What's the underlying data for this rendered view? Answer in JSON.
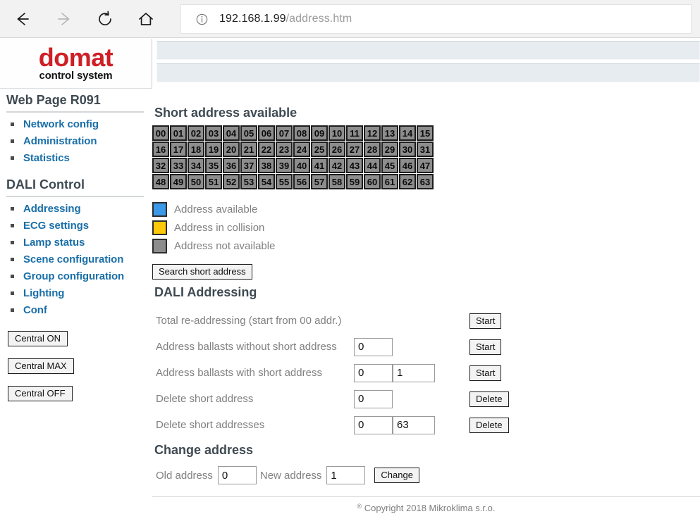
{
  "browser": {
    "back_icon": "arrow-left-icon",
    "forward_icon": "arrow-right-icon",
    "reload_icon": "reload-icon",
    "home_icon": "home-icon",
    "info_icon": "info-circle-icon",
    "url_host": "192.168.1.99",
    "url_path": "/address.htm"
  },
  "header": {
    "logo_primary": "domat",
    "logo_secondary": "control system",
    "logo_color": "#cf1f26"
  },
  "sidebar": {
    "heading_1": "Web Page R091",
    "items_1": [
      {
        "label": "Network config"
      },
      {
        "label": "Administration"
      },
      {
        "label": "Statistics"
      }
    ],
    "heading_2": "DALI Control",
    "items_2": [
      {
        "label": "Addressing"
      },
      {
        "label": "ECG settings"
      },
      {
        "label": "Lamp status"
      },
      {
        "label": "Scene configuration"
      },
      {
        "label": "Group configuration"
      },
      {
        "label": "Lighting"
      },
      {
        "label": "Conf"
      }
    ],
    "central_buttons": [
      {
        "label": "Central ON"
      },
      {
        "label": "Central MAX"
      },
      {
        "label": "Central OFF"
      }
    ],
    "link_color": "#1a6fa8"
  },
  "main": {
    "heading_short_address": "Short address available",
    "address_grid": {
      "rows": [
        [
          "00",
          "01",
          "02",
          "03",
          "04",
          "05",
          "06",
          "07",
          "08",
          "09",
          "10",
          "11",
          "12",
          "13",
          "14",
          "15"
        ],
        [
          "16",
          "17",
          "18",
          "19",
          "20",
          "21",
          "22",
          "23",
          "24",
          "25",
          "26",
          "27",
          "28",
          "29",
          "30",
          "31"
        ],
        [
          "32",
          "33",
          "34",
          "35",
          "36",
          "37",
          "38",
          "39",
          "40",
          "41",
          "42",
          "43",
          "44",
          "45",
          "46",
          "47"
        ],
        [
          "48",
          "49",
          "50",
          "51",
          "52",
          "53",
          "54",
          "55",
          "56",
          "57",
          "58",
          "59",
          "60",
          "61",
          "62",
          "63"
        ]
      ],
      "states": [
        [
          "not-available",
          "not-available",
          "not-available",
          "not-available",
          "not-available",
          "not-available",
          "not-available",
          "not-available",
          "not-available",
          "not-available",
          "not-available",
          "not-available",
          "not-available",
          "not-available",
          "not-available",
          "not-available"
        ],
        [
          "not-available",
          "not-available",
          "not-available",
          "not-available",
          "not-available",
          "not-available",
          "not-available",
          "not-available",
          "not-available",
          "not-available",
          "not-available",
          "not-available",
          "not-available",
          "not-available",
          "not-available",
          "not-available"
        ],
        [
          "not-available",
          "not-available",
          "not-available",
          "not-available",
          "not-available",
          "not-available",
          "not-available",
          "not-available",
          "not-available",
          "not-available",
          "not-available",
          "not-available",
          "not-available",
          "not-available",
          "not-available",
          "not-available"
        ],
        [
          "not-available",
          "not-available",
          "not-available",
          "not-available",
          "not-available",
          "not-available",
          "not-available",
          "not-available",
          "not-available",
          "not-available",
          "not-available",
          "not-available",
          "not-available",
          "not-available",
          "not-available",
          "not-available"
        ]
      ]
    },
    "legend": [
      {
        "label": "Address available",
        "color": "#3b9ae8"
      },
      {
        "label": "Address in collision",
        "color": "#ffc80a"
      },
      {
        "label": "Address not available",
        "color": "#8d8d8d"
      }
    ],
    "search_button": "Search short address",
    "heading_dali_addressing": "DALI Addressing",
    "rows": [
      {
        "label": "Total re-addressing (start from 00 addr.)",
        "inputs": [],
        "button": "Start"
      },
      {
        "label": "Address ballasts without short address",
        "inputs": [
          "0"
        ],
        "button": "Start"
      },
      {
        "label": "Address ballasts with short address",
        "inputs": [
          "0",
          "1"
        ],
        "button": "Start"
      },
      {
        "label": "Delete short address",
        "inputs": [
          "0"
        ],
        "button": "Delete"
      },
      {
        "label": "Delete short addresses",
        "inputs": [
          "0",
          "63"
        ],
        "button": "Delete"
      }
    ],
    "heading_change_address": "Change address",
    "change": {
      "old_label": "Old address",
      "old_value": "0",
      "new_label": "New address",
      "new_value": "1",
      "button": "Change"
    },
    "footer": "Copyright 2018 Mikroklima s.r.o."
  }
}
